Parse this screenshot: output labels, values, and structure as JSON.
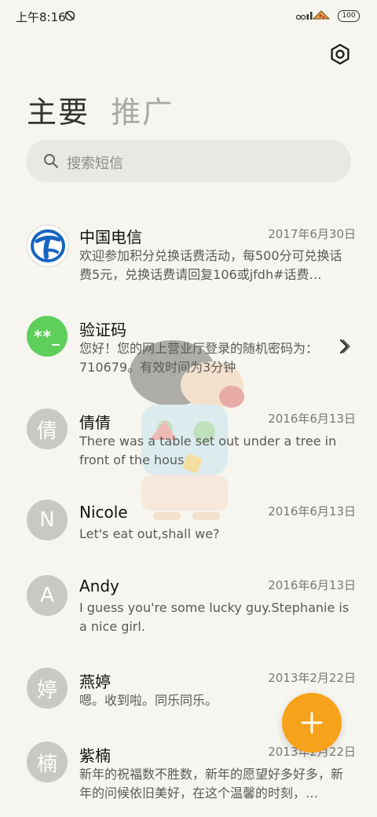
{
  "status_bar": {
    "time": "上午8:16",
    "battery": "100",
    "signal_text": "ooll"
  },
  "tabs": [
    {
      "label": "主要"
    },
    {
      "label": "推广"
    }
  ],
  "search": {
    "placeholder": "搜索短信"
  },
  "conversations": [
    {
      "avatar": "",
      "name": "中国电信",
      "date": "2017年6月30日",
      "snippet": "欢迎参加积分兑换话费活动，每500分可兑换话费5元，兑换话费请回复106或jfdh#话费…"
    },
    {
      "avatar": "**_",
      "name": "验证码",
      "date": "",
      "snippet": "您好！您的网上营业厅登录的随机密码为：710679。有效时间为3分钟"
    },
    {
      "avatar": "倩",
      "name": "倩倩",
      "date": "2016年6月13日",
      "snippet": "There was a table set out under a tree in front of the hous"
    },
    {
      "avatar": "N",
      "name": "Nicole",
      "date": "2016年6月13日",
      "snippet": "Let's eat out,shall we?"
    },
    {
      "avatar": "A",
      "name": "Andy",
      "date": "2016年6月13日",
      "snippet": "I guess you're some lucky guy.Stephanie is a nice girl."
    },
    {
      "avatar": "婷",
      "name": "燕婷",
      "date": "2013年2月22日",
      "snippet": "嗯。收到啦。同乐同乐。"
    },
    {
      "avatar": "楠",
      "name": "紫楠",
      "date": "2013年2月22日",
      "snippet": "新年的祝福数不胜数，新年的愿望好多好多，新年的问候依旧美好，在这个温馨的时刻，…"
    }
  ],
  "colors": {
    "background": "#f6f5ef",
    "fab": "#f7a21b",
    "verify_avatar": "#5ecf5b",
    "telecom_blue": "#1565c0"
  },
  "icons": {
    "settings": "settings-icon",
    "search": "search-icon",
    "compose": "plus-icon",
    "expand": "chevron-right-icon"
  }
}
